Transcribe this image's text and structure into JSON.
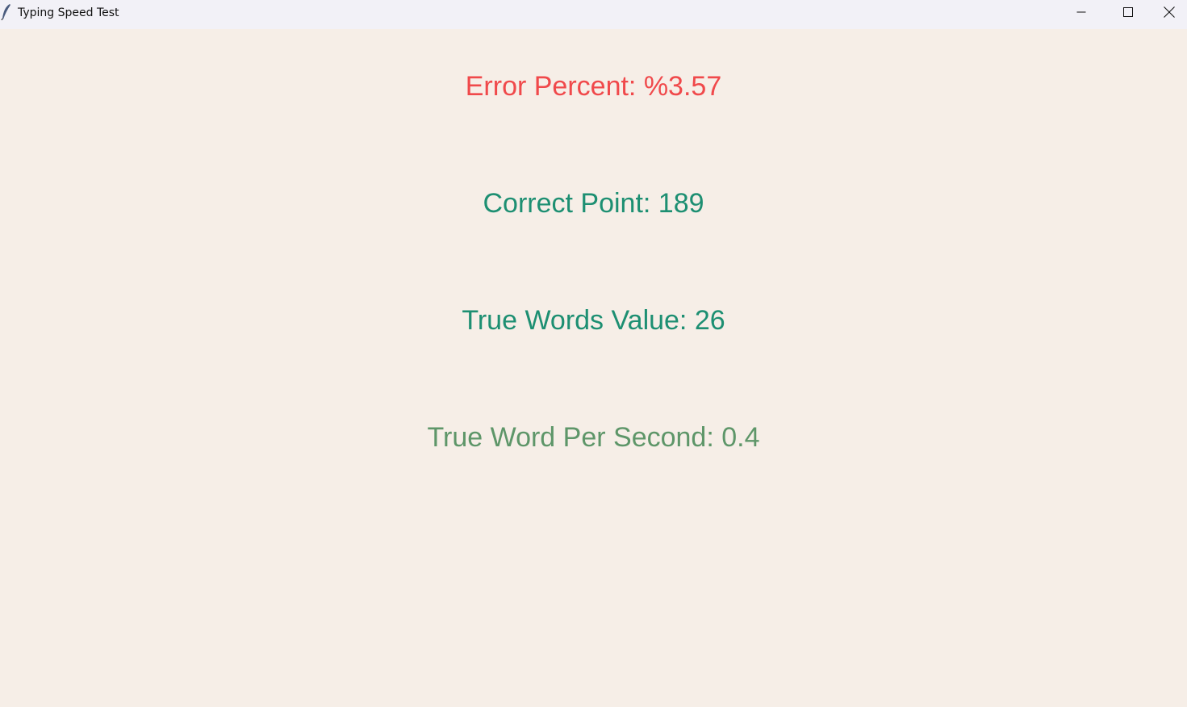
{
  "window": {
    "title": "Typing Speed Test",
    "app_icon": "feather-icon",
    "controls": {
      "minimize_icon": "minimize-icon",
      "maximize_icon": "maximize-icon",
      "close_icon": "close-icon"
    }
  },
  "results": {
    "error_percent": "Error Percent: %3.57",
    "correct_point": "Correct Point: 189",
    "true_words_value": "True Words Value: 26",
    "true_word_per_second": "True Word Per Second: 0.4"
  },
  "colors": {
    "background": "#f6eee7",
    "titlebar": "#f2f1f7",
    "error_text": "#f0494b",
    "correct_text": "#1d8f72",
    "true_words_text": "#1d8f72",
    "wps_text": "#5e9669"
  }
}
